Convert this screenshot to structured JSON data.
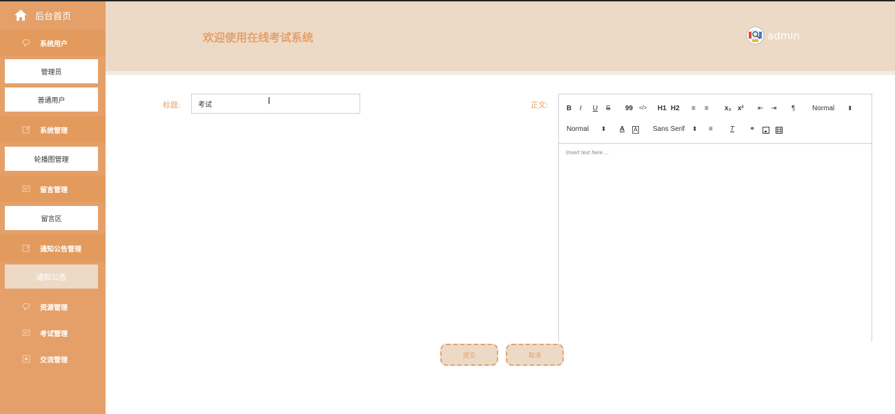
{
  "sidebar": {
    "home_label": "后台首页",
    "sections": [
      {
        "header": "系统用户",
        "icon": "chat-bubble-icon",
        "items": [
          "管理员",
          "普通用户"
        ]
      },
      {
        "header": "系统管理",
        "icon": "edit-icon",
        "items": [
          "轮播图管理"
        ]
      },
      {
        "header": "留言管理",
        "icon": "message-icon",
        "items": [
          "留言区"
        ]
      },
      {
        "header": "通知公告管理",
        "icon": "edit-icon",
        "items": [
          "通知公告"
        ]
      },
      {
        "header": "资源管理",
        "icon": "chat-bubble-icon",
        "items": []
      },
      {
        "header": "考试管理",
        "icon": "message-icon",
        "items": []
      },
      {
        "header": "交流管理",
        "icon": "square-icon",
        "items": []
      }
    ],
    "active_item": "通知公告"
  },
  "header": {
    "title": "欢迎使用在线考试系统",
    "username": "admin"
  },
  "form": {
    "title_label": "标题:",
    "title_value": "考试",
    "content_label": "正文:",
    "editor": {
      "toolbar_row1": [
        "B",
        "I",
        "U",
        "S",
        "99",
        "</>",
        "H1",
        "H2",
        "≡",
        "≡",
        "x₂",
        "x²",
        "⇤",
        "⇥",
        "¶",
        "Normal"
      ],
      "font_size": "Normal",
      "font_family": "Sans Serif",
      "placeholder": "Insert text here ..."
    },
    "submit_label": "提交",
    "cancel_label": "取消"
  },
  "colors": {
    "sidebar": "#e4a068",
    "header": "#ecdac7",
    "accent": "#e4a068"
  }
}
